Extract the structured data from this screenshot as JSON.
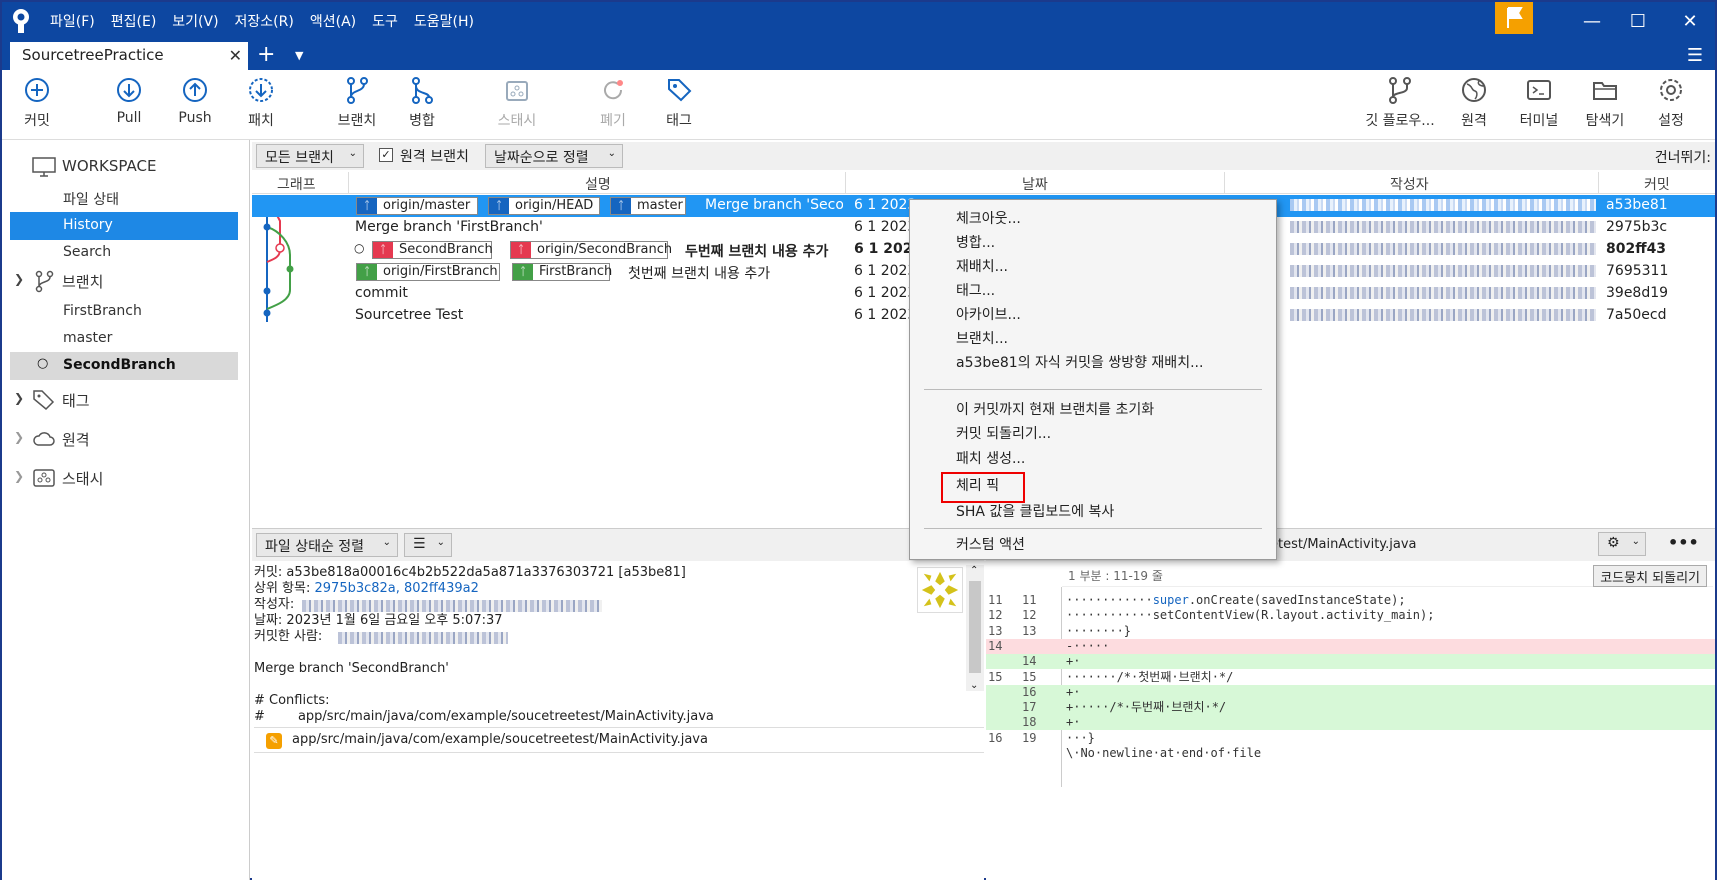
{
  "menu": [
    "파일(F)",
    "편집(E)",
    "보기(V)",
    "저장소(R)",
    "액션(A)",
    "도구",
    "도움말(H)"
  ],
  "tab": {
    "title": "SourcetreePractice"
  },
  "toolbar": {
    "left": [
      {
        "label": "커밋",
        "icon": "commit-icon"
      },
      {
        "label": "Pull",
        "icon": "pull-icon"
      },
      {
        "label": "Push",
        "icon": "push-icon"
      },
      {
        "label": "패치",
        "icon": "fetch-icon"
      },
      {
        "label": "브랜치",
        "icon": "branch-icon"
      },
      {
        "label": "병합",
        "icon": "merge-icon"
      },
      {
        "label": "스태시",
        "icon": "stash-icon",
        "disabled": true
      },
      {
        "label": "폐기",
        "icon": "discard-icon",
        "disabled": true
      },
      {
        "label": "태그",
        "icon": "tag-icon"
      }
    ],
    "right": [
      {
        "label": "깃 플로우...",
        "icon": "git-flow-icon"
      },
      {
        "label": "원격",
        "icon": "globe-icon"
      },
      {
        "label": "터미널",
        "icon": "terminal-icon"
      },
      {
        "label": "탐색기",
        "icon": "explorer-icon"
      },
      {
        "label": "설정",
        "icon": "settings-icon"
      }
    ]
  },
  "sidebar": {
    "workspace": "WORKSPACE",
    "workspace_items": [
      "파일 상태",
      "History",
      "Search"
    ],
    "branches_header": "브랜치",
    "branches": [
      "FirstBranch",
      "master",
      "SecondBranch"
    ],
    "tags_header": "태그",
    "remotes_header": "원격",
    "stash_header": "스태시"
  },
  "filter": {
    "branches": "모든 브랜치",
    "remote_branches": "원격 브랜치",
    "remote_checked": true,
    "sort": "날짜순으로 정렬",
    "jump": "건너뛰기:"
  },
  "columns": {
    "graph": "그래프",
    "description": "설명",
    "date": "날짜",
    "author": "작성자",
    "commit": "커밋"
  },
  "commits": [
    {
      "badges": [
        {
          "label": "origin/master",
          "color": "blue"
        },
        {
          "label": "origin/HEAD",
          "color": "blue"
        },
        {
          "label": "master",
          "color": "blue"
        }
      ],
      "message": "Merge branch 'Secon",
      "date": "6 1 2023",
      "hash": "a53be81",
      "selected": true
    },
    {
      "badges": [],
      "message": "Merge branch 'FirstBranch'",
      "date": "6 1 2023",
      "hash": "2975b3c"
    },
    {
      "badges": [
        {
          "label": "SecondBranch",
          "color": "red"
        },
        {
          "label": "origin/SecondBranch",
          "color": "red"
        }
      ],
      "message": "두번째 브랜치 내용 추가",
      "date": "6 1 2023",
      "hash": "802ff43",
      "bold": true
    },
    {
      "badges": [
        {
          "label": "origin/FirstBranch",
          "color": "green"
        },
        {
          "label": "FirstBranch",
          "color": "green"
        }
      ],
      "message": "첫번째 브랜치 내용 추가",
      "date": "6 1 2023",
      "hash": "7695311"
    },
    {
      "badges": [],
      "message": "commit",
      "date": "6 1 2023",
      "hash": "39e8d19"
    },
    {
      "badges": [],
      "message": "Sourcetree Test",
      "date": "6 1 2023",
      "hash": "7a50ecd"
    }
  ],
  "context_menu": {
    "items": [
      "체크아웃...",
      "병합...",
      "재배치...",
      "태그...",
      "아카이브...",
      "브랜치...",
      "a53be81의 자식 커밋을 쌍방향 재배치..."
    ],
    "items2": [
      "이 커밋까지 현재 브랜치를 초기화",
      "커밋 되돌리기...",
      "패치 생성...",
      "체리 픽",
      "SHA 값을 클립보드에 복사"
    ],
    "items3": [
      "커스텀 액션"
    ]
  },
  "details": {
    "sort": "파일 상태순 정렬",
    "commit_line": "커밋: a53be818a00016c4b2b522da5a871a3376303721 [a53be81]",
    "parents_label": "상위 항목:",
    "parents_value": "2975b3c82a, 802ff439a2",
    "author_label": "작성자:",
    "date_line": "날짜: 2023년 1월 6일 금요일 오후 5:07:37",
    "committer_label": "커밋한 사람:",
    "message": "Merge branch 'SecondBranch'",
    "conflicts": "# Conflicts:",
    "conflict_file": "#        app/src/main/java/com/example/soucetreetest/MainActivity.java",
    "file": "app/src/main/java/com/example/soucetreetest/MainActivity.java"
  },
  "diff": {
    "file_title": "eetest/MainActivity.java",
    "hunk": "1 부분 : 11-19 줄",
    "revert": "코드뭉치 되돌리기",
    "lines": [
      {
        "n1": "11",
        "n2": "11",
        "type": "ctx",
        "pre": "············",
        "kw": "super",
        "post": ".onCreate(savedInstanceState);"
      },
      {
        "n1": "12",
        "n2": "12",
        "type": "ctx",
        "pre": "············setContentView(R.layout.activity_main);"
      },
      {
        "n1": "13",
        "n2": "13",
        "type": "ctx",
        "pre": "········}"
      },
      {
        "n1": "14",
        "n2": "",
        "type": "del",
        "pre": "-·····"
      },
      {
        "n1": "",
        "n2": "14",
        "type": "add",
        "pre": "+·"
      },
      {
        "n1": "15",
        "n2": "15",
        "type": "ctx",
        "pre": "·······/*·첫번째·브랜치·*/"
      },
      {
        "n1": "",
        "n2": "16",
        "type": "add",
        "pre": "+·"
      },
      {
        "n1": "",
        "n2": "17",
        "type": "add",
        "pre": "+·····/*·두번째·브랜치·*/"
      },
      {
        "n1": "",
        "n2": "18",
        "type": "add",
        "pre": "+·"
      },
      {
        "n1": "16",
        "n2": "19",
        "type": "ctx",
        "pre": "···}"
      },
      {
        "n1": "",
        "n2": "",
        "type": "ctx",
        "pre": "\\·No·newline·at·end·of·file"
      }
    ]
  },
  "colors": {
    "accent": "#0d47a1",
    "selection": "#2196f3",
    "highlight_box": "#e00000"
  }
}
